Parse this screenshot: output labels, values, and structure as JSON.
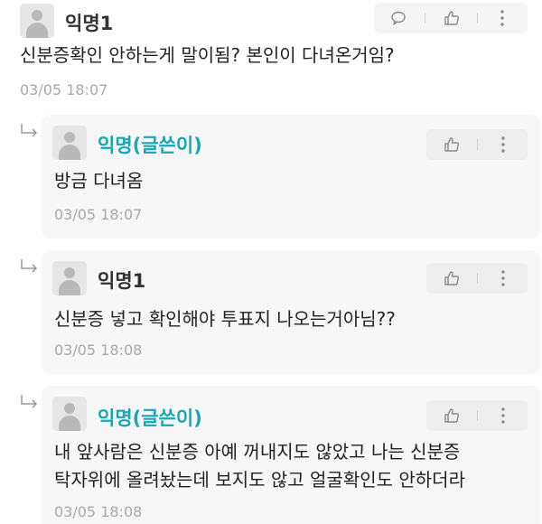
{
  "post": {
    "author": "익명1",
    "text": "신분증확인 안하는게 말이됨? 본인이 다녀온거임?",
    "time": "03/05 18:07"
  },
  "replies": [
    {
      "author": "익명(글쓴이)",
      "is_op": true,
      "lines": [
        "방금 다녀옴"
      ],
      "time": "03/05 18:07"
    },
    {
      "author": "익명1",
      "is_op": false,
      "lines": [
        "신분증 넣고 확인해야 투표지 나오는거아님??"
      ],
      "time": "03/05 18:08"
    },
    {
      "author": "익명(글쓴이)",
      "is_op": true,
      "lines": [
        "내 앞사람은 신분증 아예 꺼내지도 않았고 나는 신분증",
        "탁자위에 올려놨는데 보지도 않고 얼굴확인도 안하더라"
      ],
      "time": "03/05 18:08"
    }
  ],
  "icons": {
    "comment": "comment-icon",
    "like": "thumbs-up-icon",
    "more": "more-vertical-icon",
    "reply": "reply-arrow-icon",
    "avatar": "anonymous-avatar-icon"
  },
  "colors": {
    "op_name": "#1aa6b4",
    "card_bg": "#f7f7f7",
    "time": "#a9a9a9"
  }
}
